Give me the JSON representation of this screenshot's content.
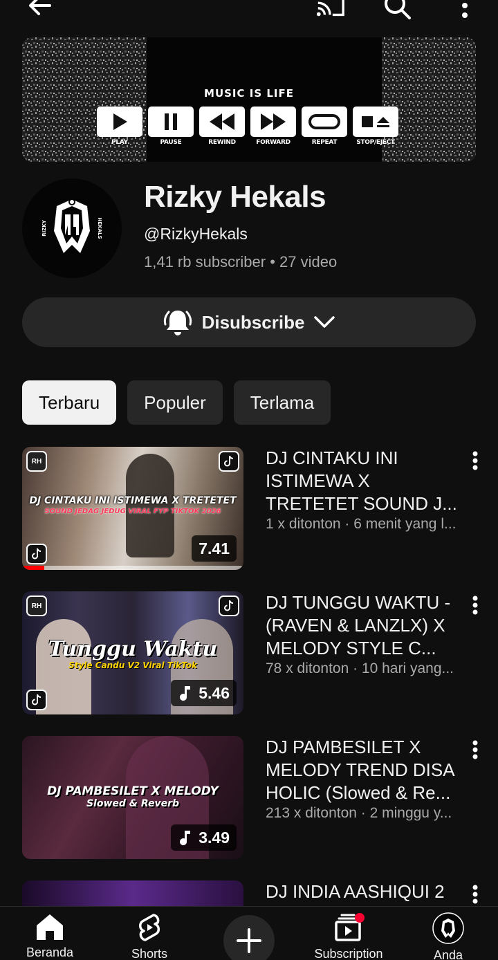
{
  "banner": {
    "title": "MUSIC IS LIFE",
    "controls": [
      "PLAY",
      "PAUSE",
      "REWIND",
      "FORWARD",
      "REPEAT",
      "STOP/EJECT"
    ]
  },
  "channel": {
    "name": "Rizky Hekals",
    "handle": "@RizkyHekals",
    "stats": "1,41 rb subscriber • 27 video",
    "avatar_text": "RIZKY",
    "avatar_text2": "HEKALS"
  },
  "subscribe": {
    "label": "Disubscribe"
  },
  "chips": [
    "Terbaru",
    "Populer",
    "Terlama"
  ],
  "videos": [
    {
      "title": "DJ CINTAKU INI ISTIMEWA X TRETETET SOUND J...",
      "meta": "1 x ditonton · 6 menit yang l...",
      "duration": "7.41",
      "thumb_text1": "DJ CINTAKU INI ISTIMEWA X TRETETET",
      "thumb_text2": "SOUND JEDAG JEDUG VIRAL FYP TIKTOK 2026",
      "progress": 0.1
    },
    {
      "title": "DJ TUNGGU WAKTU - (RAVEN & LANZLX) X MELODY STYLE C...",
      "meta": "78 x ditonton · 10 hari yang...",
      "duration": "5.46",
      "thumb_text1": "Tunggu Waktu",
      "thumb_text2": "Style Candu V2 Viral TikTok"
    },
    {
      "title": "DJ PAMBESILET X MELODY TREND DISA HOLIC (Slowed & Re...",
      "meta": "213 x ditonton · 2 minggu y...",
      "duration": "3.49",
      "thumb_text1": "DJ PAMBESILET X MELODY",
      "thumb_text2": "Slowed & Reverb"
    },
    {
      "title": "DJ INDIA AASHIQUI 2"
    }
  ],
  "nav": [
    {
      "label": "Beranda",
      "icon": "home-icon"
    },
    {
      "label": "Shorts",
      "icon": "shorts-icon"
    },
    {
      "label": "",
      "icon": "create-icon"
    },
    {
      "label": "Subscription",
      "icon": "subscriptions-icon"
    },
    {
      "label": "Anda",
      "icon": "you-avatar-icon"
    }
  ]
}
